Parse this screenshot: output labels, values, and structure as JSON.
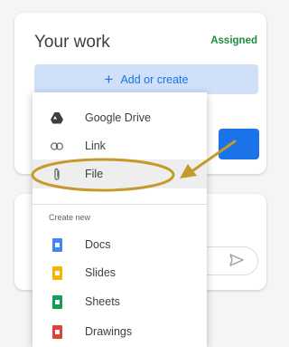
{
  "work": {
    "title": "Your work",
    "status": "Assigned"
  },
  "add_button": {
    "label": "Add or create"
  },
  "menu": {
    "items": [
      {
        "label": "Google Drive",
        "icon": "google-drive-icon"
      },
      {
        "label": "Link",
        "icon": "link-icon"
      },
      {
        "label": "File",
        "icon": "paperclip-icon"
      }
    ],
    "section_label": "Create new",
    "create_items": [
      {
        "label": "Docs",
        "icon": "docs-icon",
        "color": "#4285f4"
      },
      {
        "label": "Slides",
        "icon": "slides-icon",
        "color": "#f4b400"
      },
      {
        "label": "Sheets",
        "icon": "sheets-icon",
        "color": "#0f9d58"
      },
      {
        "label": "Drawings",
        "icon": "drawings-icon",
        "color": "#db4437"
      }
    ]
  },
  "colors": {
    "accent": "#1a73e8",
    "add_button_bg": "#cfe0f8",
    "status_green": "#1e8e3e",
    "highlight_ring": "#c49a2b"
  }
}
